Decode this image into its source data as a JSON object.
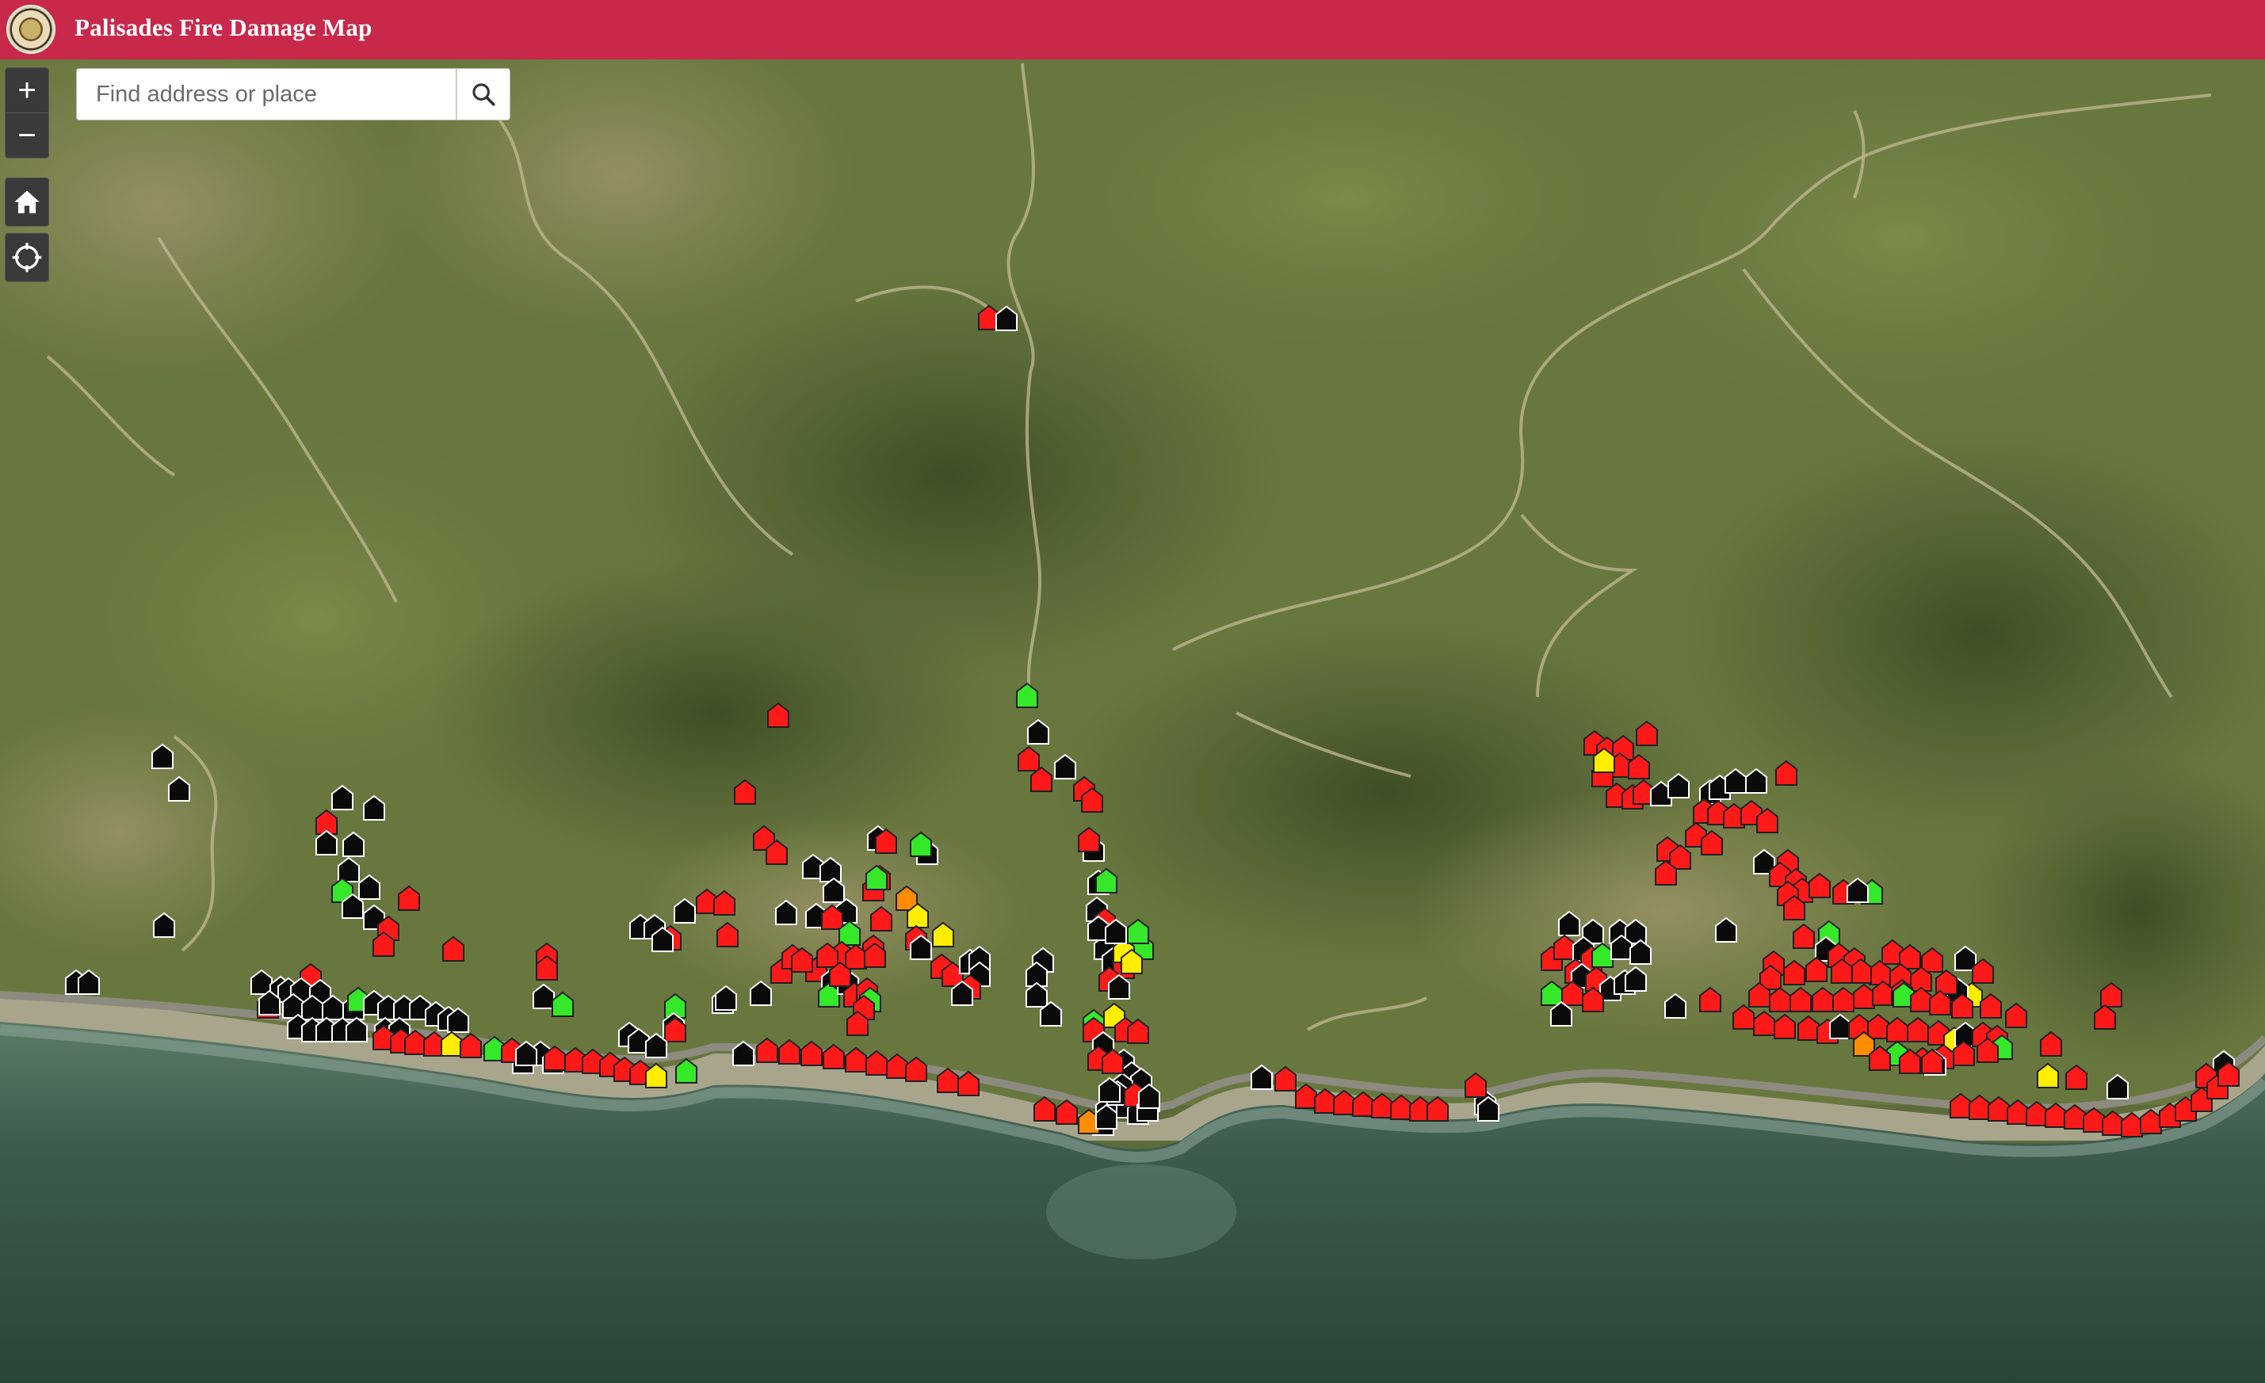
{
  "app": {
    "title": "Palisades Fire Damage Map",
    "header_color": "#c8294b"
  },
  "search": {
    "placeholder": "Find address or place",
    "value": "",
    "icon": "search-icon"
  },
  "controls": {
    "zoom_in_label": "+",
    "zoom_out_label": "−",
    "home_icon": "home-icon",
    "locate_icon": "locate-icon"
  },
  "damage_colors": {
    "destroyed": "#ff1a1a",
    "major": "#ff8c00",
    "minor": "#ffee00",
    "affected_or_none": "#36e82a",
    "inaccessible": "#0a0a0a"
  },
  "markers": [
    [
      "r",
      1248,
      401
    ],
    [
      "k",
      1270,
      402
    ],
    [
      "g",
      1296,
      878
    ],
    [
      "r",
      982,
      903
    ],
    [
      "r",
      940,
      1000
    ],
    [
      "k",
      205,
      955
    ],
    [
      "k",
      226,
      996
    ],
    [
      "k",
      432,
      1007
    ],
    [
      "k",
      472,
      1020
    ],
    [
      "r",
      412,
      1038
    ],
    [
      "k",
      412,
      1064
    ],
    [
      "k",
      446,
      1066
    ],
    [
      "k",
      440,
      1098
    ],
    [
      "g",
      432,
      1124
    ],
    [
      "k",
      466,
      1120
    ],
    [
      "k",
      445,
      1144
    ],
    [
      "r",
      516,
      1134
    ],
    [
      "k",
      472,
      1158
    ],
    [
      "r",
      490,
      1172
    ],
    [
      "r",
      484,
      1192
    ],
    [
      "r",
      572,
      1198
    ],
    [
      "k",
      207,
      1168
    ],
    [
      "k",
      1310,
      924
    ],
    [
      "r",
      1298,
      958
    ],
    [
      "k",
      1344,
      968
    ],
    [
      "r",
      1314,
      984
    ],
    [
      "r",
      1368,
      996
    ],
    [
      "r",
      1378,
      1010
    ],
    [
      "k",
      96,
      1240
    ],
    [
      "k",
      112,
      1240
    ],
    [
      "r",
      392,
      1232
    ],
    [
      "r",
      690,
      1206
    ],
    [
      "r",
      690,
      1222
    ],
    [
      "k",
      686,
      1258
    ],
    [
      "g",
      710,
      1268
    ],
    [
      "k",
      808,
      1170
    ],
    [
      "k",
      826,
      1170
    ],
    [
      "r",
      846,
      1184
    ],
    [
      "k",
      864,
      1150
    ],
    [
      "r",
      892,
      1138
    ],
    [
      "r",
      914,
      1140
    ],
    [
      "k",
      836,
      1186
    ],
    [
      "r",
      918,
      1180
    ],
    [
      "k",
      912,
      1264
    ],
    [
      "g",
      852,
      1270
    ],
    [
      "k",
      850,
      1294
    ],
    [
      "r",
      852,
      1300
    ],
    [
      "r",
      964,
      1058
    ],
    [
      "r",
      980,
      1076
    ],
    [
      "k",
      1026,
      1094
    ],
    [
      "k",
      1048,
      1098
    ],
    [
      "k",
      1052,
      1124
    ],
    [
      "k",
      1108,
      1058
    ],
    [
      "r",
      1118,
      1062
    ],
    [
      "k",
      1170,
      1076
    ],
    [
      "g",
      1162,
      1066
    ],
    [
      "r",
      1110,
      1108
    ],
    [
      "r",
      1102,
      1122
    ],
    [
      "g",
      1106,
      1108
    ],
    [
      "o",
      1144,
      1134
    ],
    [
      "k",
      1068,
      1150
    ],
    [
      "k",
      992,
      1152
    ],
    [
      "k",
      1030,
      1156
    ],
    [
      "r",
      1050,
      1158
    ],
    [
      "y",
      1158,
      1156
    ],
    [
      "r",
      1112,
      1160
    ],
    [
      "r",
      1156,
      1184
    ],
    [
      "g",
      1072,
      1178
    ],
    [
      "r",
      1102,
      1196
    ],
    [
      "k",
      1162,
      1196
    ],
    [
      "y",
      1190,
      1180
    ],
    [
      "k",
      916,
      1260
    ],
    [
      "k",
      960,
      1254
    ],
    [
      "r",
      986,
      1226
    ],
    [
      "r",
      1030,
      1224
    ],
    [
      "k",
      1050,
      1238
    ],
    [
      "g",
      1046,
      1256
    ],
    [
      "k",
      1070,
      1240
    ],
    [
      "r",
      1078,
      1256
    ],
    [
      "r",
      1094,
      1250
    ],
    [
      "g",
      1098,
      1262
    ],
    [
      "r",
      1090,
      1272
    ],
    [
      "r",
      1082,
      1292
    ],
    [
      "r",
      1188,
      1220
    ],
    [
      "r",
      1202,
      1230
    ],
    [
      "k",
      1224,
      1214
    ],
    [
      "k",
      1236,
      1210
    ],
    [
      "k",
      1236,
      1230
    ],
    [
      "r",
      1224,
      1246
    ],
    [
      "k",
      1214,
      1254
    ],
    [
      "r",
      1062,
      1204
    ],
    [
      "r",
      1080,
      1208
    ],
    [
      "r",
      1104,
      1206
    ],
    [
      "r",
      1000,
      1208
    ],
    [
      "r",
      1012,
      1212
    ],
    [
      "r",
      1044,
      1206
    ],
    [
      "r",
      1060,
      1230
    ],
    [
      "k",
      1316,
      1212
    ],
    [
      "k",
      1308,
      1230
    ],
    [
      "k",
      1308,
      1256
    ],
    [
      "k",
      1326,
      1280
    ],
    [
      "k",
      1380,
      1072
    ],
    [
      "r",
      1374,
      1060
    ],
    [
      "k",
      1386,
      1114
    ],
    [
      "g",
      1396,
      1112
    ],
    [
      "k",
      1384,
      1148
    ],
    [
      "r",
      1394,
      1162
    ],
    [
      "y",
      1418,
      1188
    ],
    [
      "g",
      1442,
      1196
    ],
    [
      "k",
      1394,
      1196
    ],
    [
      "k",
      1404,
      1212
    ],
    [
      "r",
      1418,
      1220
    ],
    [
      "r",
      1400,
      1236
    ],
    [
      "y",
      1418,
      1200
    ],
    [
      "k",
      1412,
      1246
    ],
    [
      "k",
      1386,
      1172
    ],
    [
      "k",
      1408,
      1176
    ],
    [
      "g",
      1436,
      1176
    ],
    [
      "y",
      1428,
      1214
    ],
    [
      "y",
      1406,
      1282
    ],
    [
      "g",
      1380,
      1290
    ],
    [
      "r",
      1380,
      1300
    ],
    [
      "r",
      1420,
      1300
    ],
    [
      "r",
      1436,
      1302
    ],
    [
      "k",
      1392,
      1318
    ],
    [
      "k",
      1418,
      1340
    ],
    [
      "k",
      1428,
      1356
    ],
    [
      "k",
      1440,
      1364
    ],
    [
      "k",
      1416,
      1370
    ],
    [
      "k",
      1450,
      1388
    ],
    [
      "k",
      1418,
      1396
    ],
    [
      "k",
      1396,
      1400
    ],
    [
      "k",
      1436,
      1404
    ],
    [
      "k",
      1410,
      1380
    ],
    [
      "r",
      1432,
      1382
    ],
    [
      "k",
      1392,
      1418
    ],
    [
      "r",
      1386,
      1336
    ],
    [
      "k",
      1448,
      1400
    ],
    [
      "k",
      1450,
      1384
    ],
    [
      "r",
      1404,
      1340
    ],
    [
      "k",
      1400,
      1376
    ],
    [
      "k",
      330,
      1240
    ],
    [
      "r",
      338,
      1270
    ],
    [
      "k",
      354,
      1248
    ],
    [
      "k",
      364,
      1250
    ],
    [
      "k",
      380,
      1250
    ],
    [
      "k",
      404,
      1252
    ],
    [
      "k",
      340,
      1266
    ],
    [
      "k",
      370,
      1270
    ],
    [
      "k",
      394,
      1272
    ],
    [
      "k",
      420,
      1272
    ],
    [
      "k",
      446,
      1272
    ],
    [
      "g",
      452,
      1262
    ],
    [
      "k",
      472,
      1266
    ],
    [
      "k",
      490,
      1272
    ],
    [
      "k",
      510,
      1272
    ],
    [
      "k",
      530,
      1272
    ],
    [
      "k",
      550,
      1280
    ],
    [
      "k",
      566,
      1286
    ],
    [
      "k",
      578,
      1288
    ],
    [
      "k",
      376,
      1296
    ],
    [
      "k",
      394,
      1300
    ],
    [
      "k",
      412,
      1300
    ],
    [
      "k",
      432,
      1300
    ],
    [
      "k",
      450,
      1300
    ],
    [
      "k",
      486,
      1300
    ],
    [
      "k",
      504,
      1300
    ],
    [
      "k",
      794,
      1306
    ],
    [
      "k",
      806,
      1314
    ],
    [
      "k",
      828,
      1320
    ],
    [
      "k",
      682,
      1330
    ],
    [
      "k",
      698,
      1340
    ],
    [
      "k",
      660,
      1340
    ],
    [
      "k",
      938,
      1330
    ],
    [
      "r",
      484,
      1310
    ],
    [
      "r",
      506,
      1314
    ],
    [
      "r",
      524,
      1316
    ],
    [
      "r",
      548,
      1318
    ],
    [
      "y",
      570,
      1318
    ],
    [
      "r",
      594,
      1320
    ],
    [
      "g",
      624,
      1324
    ],
    [
      "r",
      646,
      1326
    ],
    [
      "k",
      664,
      1330
    ],
    [
      "r",
      700,
      1336
    ],
    [
      "r",
      726,
      1338
    ],
    [
      "r",
      748,
      1340
    ],
    [
      "r",
      770,
      1344
    ],
    [
      "r",
      788,
      1350
    ],
    [
      "r",
      808,
      1354
    ],
    [
      "y",
      828,
      1358
    ],
    [
      "g",
      866,
      1352
    ],
    [
      "r",
      968,
      1326
    ],
    [
      "r",
      996,
      1328
    ],
    [
      "r",
      1024,
      1330
    ],
    [
      "r",
      1052,
      1334
    ],
    [
      "r",
      1080,
      1338
    ],
    [
      "r",
      1106,
      1342
    ],
    [
      "r",
      1132,
      1346
    ],
    [
      "r",
      1156,
      1350
    ],
    [
      "r",
      1196,
      1364
    ],
    [
      "r",
      1222,
      1368
    ],
    [
      "r",
      1318,
      1400
    ],
    [
      "r",
      1346,
      1404
    ],
    [
      "o",
      1374,
      1416
    ],
    [
      "k",
      1396,
      1410
    ],
    [
      "k",
      1592,
      1360
    ],
    [
      "r",
      1622,
      1362
    ],
    [
      "r",
      1648,
      1384
    ],
    [
      "r",
      1672,
      1390
    ],
    [
      "r",
      1696,
      1392
    ],
    [
      "r",
      1720,
      1394
    ],
    [
      "r",
      1744,
      1396
    ],
    [
      "r",
      1768,
      1398
    ],
    [
      "r",
      1792,
      1400
    ],
    [
      "r",
      1814,
      1400
    ],
    [
      "k",
      1874,
      1392
    ],
    [
      "r",
      1862,
      1370
    ],
    [
      "k",
      1878,
      1400
    ],
    [
      "r",
      2012,
      938
    ],
    [
      "r",
      2028,
      946
    ],
    [
      "r",
      2048,
      944
    ],
    [
      "r",
      2078,
      926
    ],
    [
      "r",
      2044,
      966
    ],
    [
      "r",
      2068,
      968
    ],
    [
      "r",
      2022,
      978
    ],
    [
      "r",
      2040,
      1004
    ],
    [
      "r",
      2060,
      1006
    ],
    [
      "r",
      2074,
      1000
    ],
    [
      "y",
      2024,
      960
    ],
    [
      "k",
      2096,
      1002
    ],
    [
      "k",
      2118,
      992
    ],
    [
      "k",
      2158,
      1000
    ],
    [
      "k",
      2170,
      994
    ],
    [
      "k",
      2190,
      986
    ],
    [
      "k",
      2216,
      986
    ],
    [
      "r",
      2254,
      976
    ],
    [
      "r",
      2150,
      1024
    ],
    [
      "r",
      2168,
      1026
    ],
    [
      "r",
      2188,
      1030
    ],
    [
      "r",
      2210,
      1026
    ],
    [
      "r",
      2230,
      1036
    ],
    [
      "r",
      2140,
      1054
    ],
    [
      "r",
      2160,
      1064
    ],
    [
      "r",
      2104,
      1072
    ],
    [
      "r",
      2120,
      1082
    ],
    [
      "r",
      2102,
      1102
    ],
    [
      "k",
      2226,
      1088
    ],
    [
      "r",
      2256,
      1088
    ],
    [
      "r",
      2246,
      1104
    ],
    [
      "r",
      2266,
      1112
    ],
    [
      "r",
      2274,
      1124
    ],
    [
      "r",
      2256,
      1128
    ],
    [
      "r",
      2264,
      1146
    ],
    [
      "r",
      2296,
      1118
    ],
    [
      "r",
      2326,
      1126
    ],
    [
      "g",
      2362,
      1126
    ],
    [
      "k",
      2344,
      1124
    ],
    [
      "k",
      1980,
      1166
    ],
    [
      "k",
      2010,
      1176
    ],
    [
      "k",
      2044,
      1176
    ],
    [
      "k",
      2064,
      1176
    ],
    [
      "r",
      1958,
      1210
    ],
    [
      "r",
      1974,
      1196
    ],
    [
      "k",
      1998,
      1198
    ],
    [
      "r",
      2008,
      1210
    ],
    [
      "g",
      2022,
      1206
    ],
    [
      "k",
      2046,
      1196
    ],
    [
      "k",
      2070,
      1202
    ],
    [
      "r",
      1988,
      1226
    ],
    [
      "k",
      1996,
      1232
    ],
    [
      "r",
      2014,
      1236
    ],
    [
      "k",
      2032,
      1248
    ],
    [
      "k",
      2050,
      1240
    ],
    [
      "k",
      2064,
      1236
    ],
    [
      "g",
      1958,
      1254
    ],
    [
      "r",
      1984,
      1254
    ],
    [
      "r",
      2010,
      1262
    ],
    [
      "k",
      1970,
      1280
    ],
    [
      "k",
      2114,
      1270
    ],
    [
      "r",
      2158,
      1262
    ],
    [
      "k",
      2178,
      1174
    ],
    [
      "r",
      2238,
      1216
    ],
    [
      "g",
      2308,
      1178
    ],
    [
      "r",
      2276,
      1182
    ],
    [
      "k",
      2304,
      1198
    ],
    [
      "r",
      2320,
      1206
    ],
    [
      "r",
      2340,
      1212
    ],
    [
      "r",
      2388,
      1202
    ],
    [
      "r",
      2410,
      1208
    ],
    [
      "r",
      2438,
      1212
    ],
    [
      "k",
      2480,
      1210
    ],
    [
      "r",
      2502,
      1226
    ],
    [
      "y",
      2488,
      1256
    ],
    [
      "k",
      2470,
      1250
    ],
    [
      "r",
      2456,
      1240
    ],
    [
      "r",
      2424,
      1236
    ],
    [
      "r",
      2398,
      1232
    ],
    [
      "r",
      2372,
      1228
    ],
    [
      "r",
      2348,
      1226
    ],
    [
      "r",
      2324,
      1226
    ],
    [
      "r",
      2292,
      1224
    ],
    [
      "r",
      2264,
      1228
    ],
    [
      "r",
      2234,
      1234
    ],
    [
      "r",
      2220,
      1256
    ],
    [
      "r",
      2246,
      1262
    ],
    [
      "r",
      2272,
      1262
    ],
    [
      "r",
      2300,
      1262
    ],
    [
      "r",
      2326,
      1262
    ],
    [
      "r",
      2352,
      1258
    ],
    [
      "r",
      2376,
      1254
    ],
    [
      "r",
      2400,
      1252
    ],
    [
      "g",
      2402,
      1256
    ],
    [
      "r",
      2424,
      1262
    ],
    [
      "r",
      2448,
      1266
    ],
    [
      "r",
      2476,
      1270
    ],
    [
      "r",
      2512,
      1270
    ],
    [
      "r",
      2544,
      1282
    ],
    [
      "r",
      2200,
      1284
    ],
    [
      "r",
      2226,
      1292
    ],
    [
      "r",
      2252,
      1296
    ],
    [
      "r",
      2282,
      1298
    ],
    [
      "r",
      2306,
      1302
    ],
    [
      "k",
      2322,
      1296
    ],
    [
      "r",
      2346,
      1296
    ],
    [
      "r",
      2370,
      1296
    ],
    [
      "r",
      2394,
      1300
    ],
    [
      "r",
      2420,
      1300
    ],
    [
      "r",
      2446,
      1304
    ],
    [
      "y",
      2466,
      1312
    ],
    [
      "k",
      2480,
      1306
    ],
    [
      "r",
      2502,
      1306
    ],
    [
      "r",
      2520,
      1310
    ],
    [
      "g",
      2526,
      1322
    ],
    [
      "r",
      2508,
      1326
    ],
    [
      "r",
      2478,
      1330
    ],
    [
      "r",
      2452,
      1334
    ],
    [
      "r",
      2426,
      1338
    ],
    [
      "k",
      2442,
      1342
    ],
    [
      "o",
      2352,
      1318
    ],
    [
      "g",
      2394,
      1330
    ],
    [
      "r",
      2372,
      1336
    ],
    [
      "r",
      2410,
      1340
    ],
    [
      "r",
      2438,
      1340
    ],
    [
      "r",
      2588,
      1318
    ],
    [
      "r",
      2664,
      1256
    ],
    [
      "r",
      2656,
      1284
    ],
    [
      "y",
      2584,
      1358
    ],
    [
      "r",
      2620,
      1360
    ],
    [
      "k",
      2672,
      1372
    ],
    [
      "k",
      2806,
      1342
    ],
    [
      "r",
      2784,
      1358
    ],
    [
      "r",
      2474,
      1396
    ],
    [
      "r",
      2498,
      1398
    ],
    [
      "r",
      2522,
      1400
    ],
    [
      "r",
      2546,
      1404
    ],
    [
      "r",
      2570,
      1406
    ],
    [
      "r",
      2594,
      1408
    ],
    [
      "r",
      2618,
      1410
    ],
    [
      "r",
      2642,
      1414
    ],
    [
      "r",
      2666,
      1418
    ],
    [
      "r",
      2690,
      1420
    ],
    [
      "r",
      2714,
      1416
    ],
    [
      "r",
      2738,
      1408
    ],
    [
      "r",
      2758,
      1400
    ],
    [
      "r",
      2778,
      1388
    ],
    [
      "r",
      2798,
      1372
    ],
    [
      "r",
      2812,
      1356
    ]
  ]
}
